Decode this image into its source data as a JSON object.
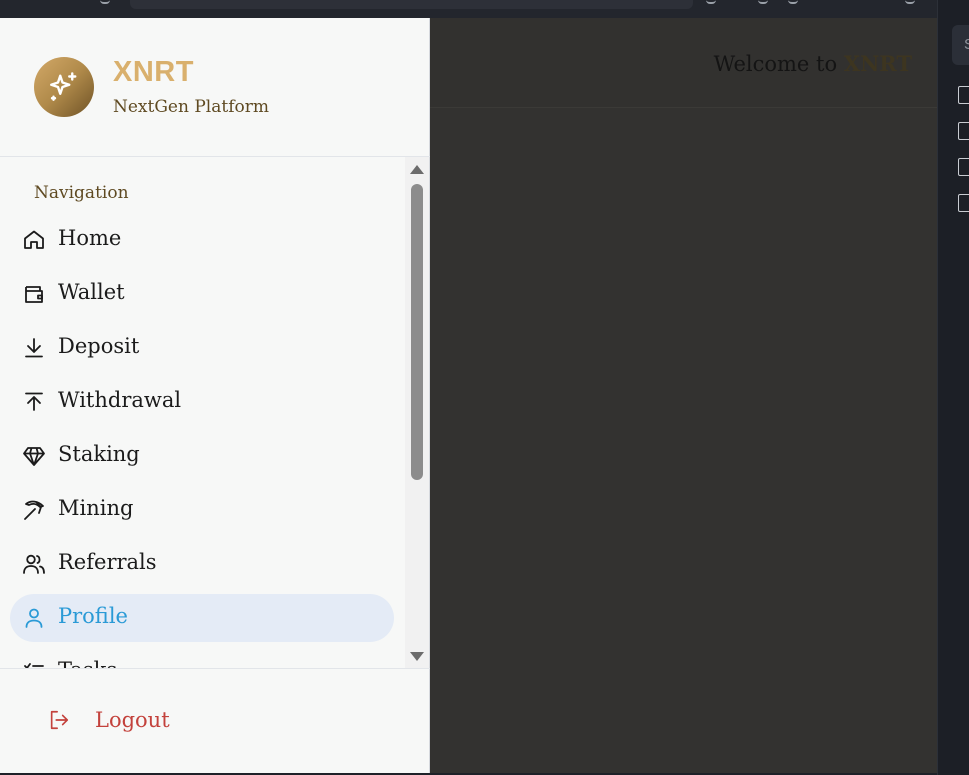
{
  "brand": {
    "name": "XNRT",
    "subtitle": "NextGen Platform"
  },
  "header": {
    "welcome_prefix": "Welcome to ",
    "welcome_brand": "XNRT"
  },
  "nav": {
    "heading": "Navigation",
    "items": [
      {
        "label": "Home",
        "icon": "home-icon"
      },
      {
        "label": "Wallet",
        "icon": "wallet-icon"
      },
      {
        "label": "Deposit",
        "icon": "download-icon"
      },
      {
        "label": "Withdrawal",
        "icon": "upload-icon"
      },
      {
        "label": "Staking",
        "icon": "gem-icon"
      },
      {
        "label": "Mining",
        "icon": "pickaxe-icon"
      },
      {
        "label": "Referrals",
        "icon": "users-icon"
      },
      {
        "label": "Profile",
        "icon": "user-icon",
        "active": true
      },
      {
        "label": "Tasks",
        "icon": "list-check-icon"
      }
    ]
  },
  "footer": {
    "logout_label": "Logout"
  },
  "right_pane": {
    "search_placeholder": "S"
  },
  "colors": {
    "accent_gold": "#d9b06d",
    "active_blue": "#2a9ad6",
    "active_bg": "#e4ebf6",
    "logout_red": "#c3423c"
  }
}
